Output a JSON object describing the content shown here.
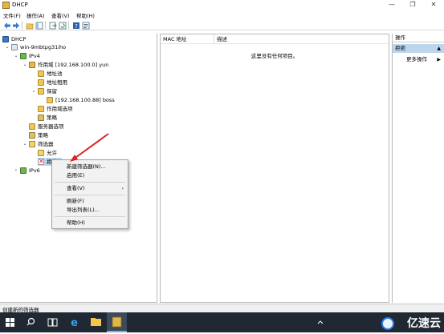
{
  "window": {
    "title": "DHCP",
    "minimize_label": "—",
    "maximize_label": "❐",
    "close_label": "✕"
  },
  "menu": [
    "文件(F)",
    "操作(A)",
    "查看(V)",
    "帮助(H)"
  ],
  "toolbar": {
    "icons": [
      "back-icon",
      "forward-icon",
      "folder-up-icon",
      "show-hide-tree-icon",
      "export-list-icon",
      "refresh-icon",
      "help-icon",
      "properties-icon"
    ]
  },
  "tree": {
    "root": "DHCP",
    "server": "win-9mbtpg31iho",
    "ipv4": "IPv4",
    "scope": "作用域 [192.168.100.0] yun",
    "address_pool": "地址池",
    "address_leases": "地址租用",
    "reservations": "保留",
    "reservation_item": "[192.168.100.88] boss",
    "scope_options": "作用域选项",
    "scope_policies": "策略",
    "server_options": "服务器选项",
    "policies": "策略",
    "filters": "筛选器",
    "allow": "允许",
    "deny": "拒绝",
    "ipv6": "IPv6"
  },
  "list": {
    "columns": [
      "MAC 地址",
      "描述"
    ],
    "empty_message": "这里没有任何项目。"
  },
  "actions": {
    "title": "操作",
    "section": "拒绝",
    "more": "更多操作"
  },
  "context_menu": {
    "items": [
      "新建筛选器(N)...",
      "启用(E)",
      "查看(V)",
      "刷新(F)",
      "导出列表(L)...",
      "帮助(H)"
    ]
  },
  "status": {
    "text": "创建新的筛选器"
  },
  "taskbar": {
    "icons": [
      "start-icon",
      "search-icon",
      "task-view-icon",
      "edge-icon",
      "file-explorer-icon",
      "dhcp-app-icon"
    ],
    "watermark": "亿速云"
  },
  "colors": {
    "selection": "#bcd6ee",
    "arrow": "#e02020",
    "taskbar": "#1f2833"
  }
}
